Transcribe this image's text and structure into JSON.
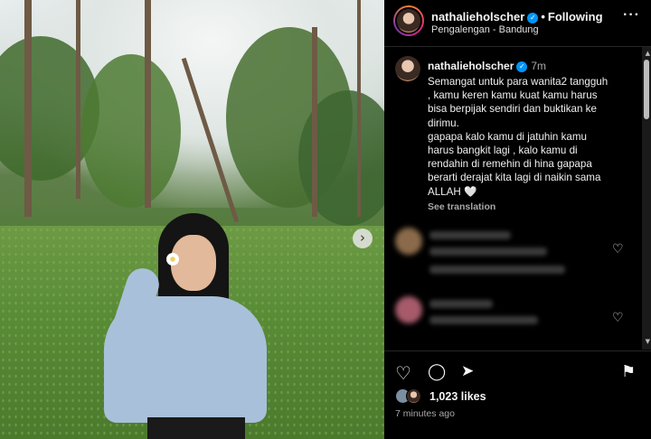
{
  "post": {
    "next_icon": "chevron-right-icon",
    "next_glyph": "›"
  },
  "header": {
    "username": "nathalieholscher",
    "verified_glyph": "✓",
    "separator": "•",
    "follow_status": "Following",
    "location": "Pengalengan - Bandung",
    "more_glyph": "···"
  },
  "caption": {
    "username": "nathalieholscher",
    "time": "7m",
    "text": "Semangat untuk para wanita2 tangguh\n, kamu keren kamu kuat kamu harus\nbisa berpijak sendiri dan buktikan ke\ndirimu.\ngapapa kalo kamu di jatuhin kamu\nharus bangkit lagi , kalo kamu di\nrendahin di remehin di hina gapapa\nberarti derajat kita lagi di naikin sama\nALLAH 🤍",
    "see_translation": "See translation"
  },
  "comments": {
    "like_glyph": "♡"
  },
  "scrollbar": {
    "up_glyph": "▲",
    "down_glyph": "▼"
  },
  "actions": {
    "like_glyph": "♡",
    "comment_glyph": "◯",
    "share_glyph": "➤",
    "save_glyph": "⚑",
    "likes": "1,023 likes",
    "posted": "7 minutes ago"
  },
  "colors": {
    "background": "#000000",
    "verified": "#0095f6",
    "muted_text": "#a8a8a8",
    "divider": "#262626"
  }
}
